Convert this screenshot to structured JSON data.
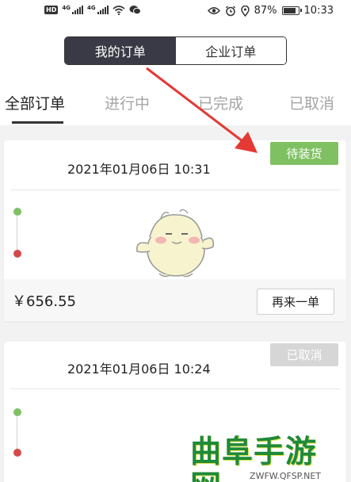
{
  "status_bar": {
    "hd_badge": "HD",
    "network_labels": [
      "4G",
      "4G"
    ],
    "battery_percent": "87%",
    "battery_level": 0.87,
    "time": "10:33",
    "icons": [
      "hd-icon",
      "signal-icon",
      "signal-icon",
      "wifi-icon",
      "wechat-icon",
      "eye-icon",
      "alarm-icon",
      "location-icon",
      "battery-icon"
    ]
  },
  "segment": {
    "options": [
      "我的订单",
      "企业订单"
    ],
    "selected": "我的订单"
  },
  "tabs": {
    "items": [
      "全部订单",
      "进行中",
      "已完成",
      "已取消"
    ],
    "active": "全部订单"
  },
  "orders": [
    {
      "status": "待装货",
      "status_color": "#7fc062",
      "datetime": "2021年01月06日 10:31",
      "price": "￥656.55",
      "action_label": "再来一单"
    },
    {
      "status": "已取消",
      "status_color": "#d6d6d6",
      "datetime": "2021年01月06日 10:24"
    }
  ],
  "annotation": {
    "arrow_color": "#e53935"
  },
  "watermark": {
    "title": "曲阜手游网",
    "url": "ZWFW.QFSP.NET",
    "color": "#1f8a3a"
  }
}
